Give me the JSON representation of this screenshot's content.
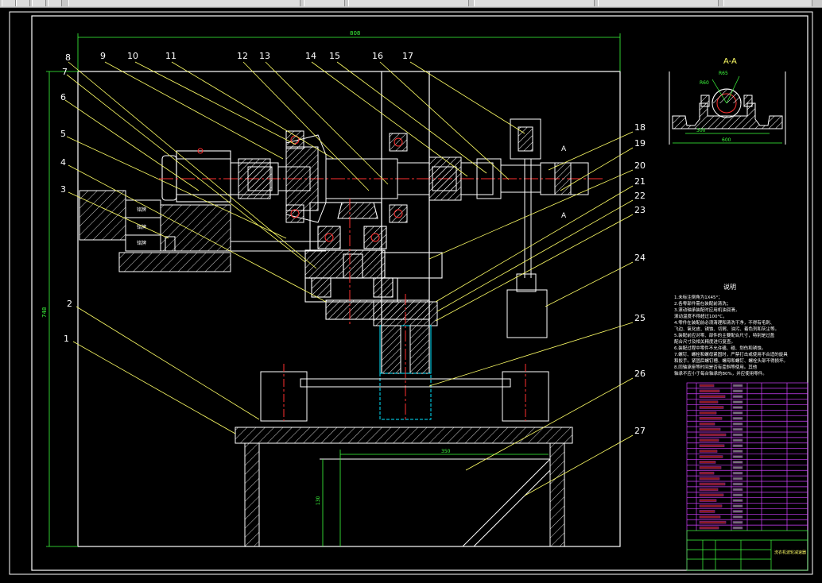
{
  "toolbar": {
    "buttons": [
      {
        "name": "new-file-button"
      },
      {
        "name": "open-file-button"
      },
      {
        "name": "save-file-button"
      },
      {
        "name": "print-button"
      },
      {
        "name": "layer-dropdown"
      },
      {
        "name": "color-dropdown"
      },
      {
        "name": "linetype-dropdown"
      },
      {
        "name": "lineweight-dropdown"
      },
      {
        "name": "plotstyle-dropdown"
      }
    ]
  },
  "drawing": {
    "width_dim": "808",
    "height_dim": "748",
    "base_dim_width": "350",
    "base_dim_height": "130",
    "part_numbers_top": [
      "8",
      "7",
      "6",
      "5",
      "4",
      "3",
      "9",
      "10",
      "11",
      "12",
      "13",
      "14",
      "15",
      "16",
      "17"
    ],
    "part_numbers_right": [
      "18",
      "19",
      "20",
      "21",
      "22",
      "23",
      "24",
      "25",
      "26",
      "27"
    ],
    "part_numbers_left": [
      "2",
      "1"
    ],
    "section_mark": "A",
    "motor_labels": [
      "铭牌",
      "铭牌",
      "铭牌"
    ]
  },
  "section_view": {
    "title": "A-A",
    "dim_inner": "300",
    "dim_outer": "600",
    "radius_1": "R60",
    "radius_2": "R65"
  },
  "notes": {
    "title": "说明",
    "lines": [
      "1.未标注倒角为1X45°；",
      "2.各零部件需在装配前清洗；",
      "3.滚动轴承装配时应用机油润滑，",
      "  滚动温度不得超过100°C，",
      "4.零件在装配前必须清理和清洗干净，不得有毛刺、",
      "  飞边、氧化皮、锈蚀、切屑、油污、着色剂和灰尘等。",
      "5.装配前应对零、部件的主要配合尺寸，特别是过盈",
      "  配合尺寸及相关精度进行复查。",
      "6.装配过程中零件不允许磕、碰、划伤和锈蚀。",
      "7.螺钉、螺栓和螺母紧固时，严禁打击或使用不合适的旋具",
      "  和扳手。紧固后螺钉槽、螺母和螺钉、螺栓头部不得损坏。",
      "8.同轴承座等时间是否有歪斜等使用。其他",
      "  轴承不应小于每台轴承的80%，并应使用零件。"
    ]
  },
  "title_block": {
    "rows": 27,
    "bottom_title": "洗衣机波轮减速器"
  },
  "colors": {
    "frame": "#ffffff",
    "outline": "#ffffff",
    "hatch": "#ffffff",
    "center": "#ff3030",
    "leader": "#ffff66",
    "part": "#ff3030",
    "bearing": "#ffffff",
    "cyan": "#00e5ff",
    "green": "#3dff3d",
    "magenta": "#d040ff",
    "yellow": "#ffff00"
  }
}
